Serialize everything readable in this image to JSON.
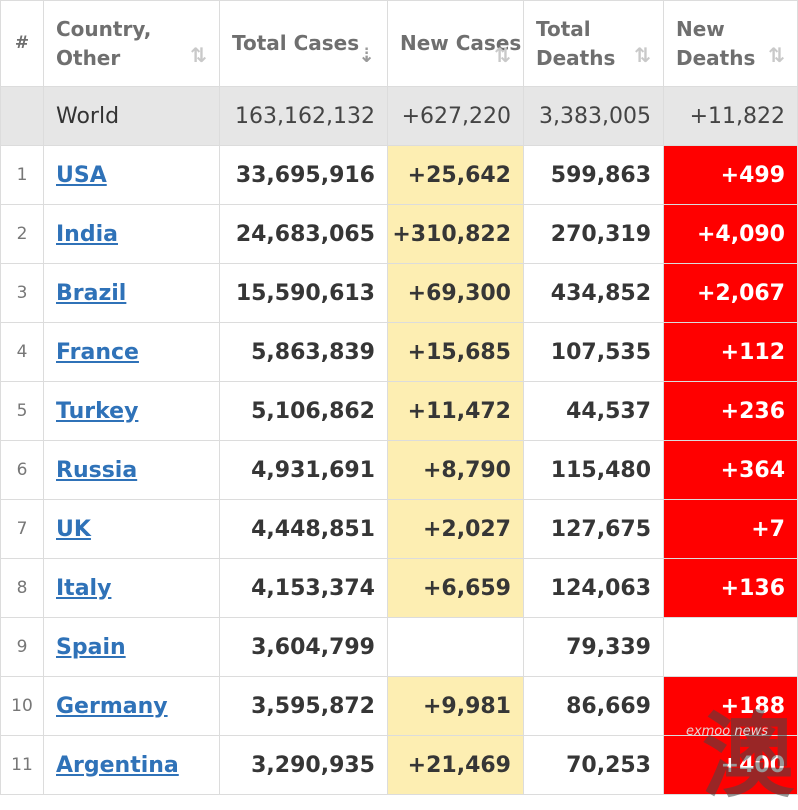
{
  "table": {
    "headers": {
      "index": "#",
      "country": "Country, Other",
      "total_cases": "Total Cases",
      "new_cases": "New Cases",
      "total_deaths": "Total Deaths",
      "new_deaths": "New Deaths"
    },
    "world": {
      "country": "World",
      "total_cases": "163,162,132",
      "new_cases": "+627,220",
      "total_deaths": "3,383,005",
      "new_deaths": "+11,822"
    },
    "rows": [
      {
        "index": "1",
        "country": "USA",
        "total_cases": "33,695,916",
        "new_cases": "+25,642",
        "total_deaths": "599,863",
        "new_deaths": "+499"
      },
      {
        "index": "2",
        "country": "India",
        "total_cases": "24,683,065",
        "new_cases": "+310,822",
        "total_deaths": "270,319",
        "new_deaths": "+4,090"
      },
      {
        "index": "3",
        "country": "Brazil",
        "total_cases": "15,590,613",
        "new_cases": "+69,300",
        "total_deaths": "434,852",
        "new_deaths": "+2,067"
      },
      {
        "index": "4",
        "country": "France",
        "total_cases": "5,863,839",
        "new_cases": "+15,685",
        "total_deaths": "107,535",
        "new_deaths": "+112"
      },
      {
        "index": "5",
        "country": "Turkey",
        "total_cases": "5,106,862",
        "new_cases": "+11,472",
        "total_deaths": "44,537",
        "new_deaths": "+236"
      },
      {
        "index": "6",
        "country": "Russia",
        "total_cases": "4,931,691",
        "new_cases": "+8,790",
        "total_deaths": "115,480",
        "new_deaths": "+364"
      },
      {
        "index": "7",
        "country": "UK",
        "total_cases": "4,448,851",
        "new_cases": "+2,027",
        "total_deaths": "127,675",
        "new_deaths": "+7"
      },
      {
        "index": "8",
        "country": "Italy",
        "total_cases": "4,153,374",
        "new_cases": "+6,659",
        "total_deaths": "124,063",
        "new_deaths": "+136"
      },
      {
        "index": "9",
        "country": "Spain",
        "total_cases": "3,604,799",
        "new_cases": "",
        "total_deaths": "79,339",
        "new_deaths": ""
      },
      {
        "index": "10",
        "country": "Germany",
        "total_cases": "3,595,872",
        "new_cases": "+9,981",
        "total_deaths": "86,669",
        "new_deaths": "+188"
      },
      {
        "index": "11",
        "country": "Argentina",
        "total_cases": "3,290,935",
        "new_cases": "+21,469",
        "total_deaths": "70,253",
        "new_deaths": "+400"
      }
    ]
  },
  "watermark": {
    "brand": "exmoo news",
    "glyph": "澳",
    "icon": "watermark-logo"
  },
  "colors": {
    "link": "#2f72b8",
    "new_cases_highlight": "#fdeeb2",
    "new_deaths_highlight": "#ff0000",
    "world_row": "#e6e6e6"
  },
  "icons": {
    "sort": "sort-arrows-icon",
    "sort_active": "sort-descending-icon"
  }
}
